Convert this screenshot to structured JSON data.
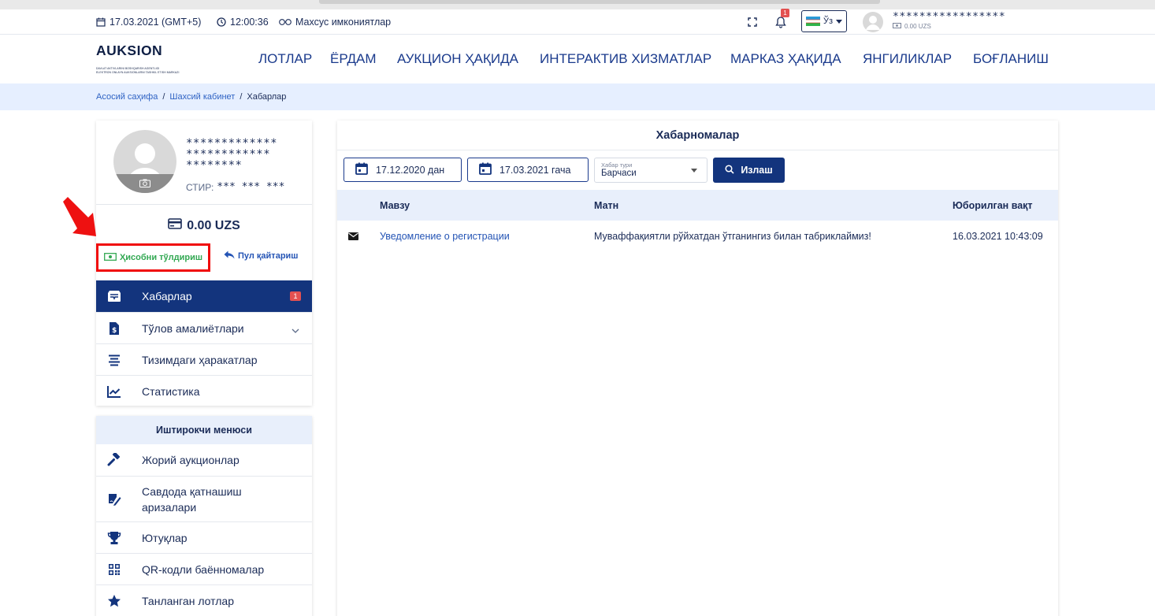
{
  "topbar": {
    "date": "17.03.2021 (GMT+5)",
    "time": "12:00:36",
    "special": "Махсус имкониятлар",
    "notif_count": "1",
    "lang": "Ўз",
    "user_name": "*****************",
    "user_balance": "0.00 UZS"
  },
  "header": {
    "logo_word": "AUKSION",
    "logo_sub1": "DAVLAT AKTIVLARINI BOSHQARISH AGENTLIGI",
    "logo_sub2": "ELEKTRON ONLAYN AUKSIONLARNI TASHKIL ETISH MARKAZI",
    "nav": [
      "ЛОТЛАР",
      "ЁРДАМ",
      "АУКЦИОН ҲАҚИДА",
      "ИНТЕРАКТИВ ХИЗМАТЛАР",
      "МАРКАЗ ҲАҚИДА",
      "ЯНГИЛИКЛАР",
      "БОҒЛАНИШ"
    ]
  },
  "breadcrumb": {
    "home": "Асосий саҳифа",
    "cabinet": "Шахсий кабинет",
    "current": "Хабарлар",
    "sep": "/"
  },
  "profile": {
    "name_lines": [
      "*************",
      "************",
      "********"
    ],
    "stir_label": "СТИР:",
    "stir_value": "*** *** ***",
    "balance": "0.00 UZS",
    "topup_label": "Ҳисобни тўлдириш",
    "refund_label": "Пул қайтариш",
    "menu": [
      {
        "label": "Хабарлар",
        "badge": "1",
        "active": true,
        "icon": "inbox-icon"
      },
      {
        "label": "Тўлов амалиётлари",
        "icon": "payment-doc-icon"
      },
      {
        "label": "Тизимдаги ҳаракатлар",
        "icon": "list-icon"
      },
      {
        "label": "Статистика",
        "icon": "chart-icon"
      }
    ]
  },
  "participant_menu": {
    "title": "Иштирокчи менюси",
    "items": [
      {
        "label": "Жорий аукционлар",
        "icon": "gavel-icon"
      },
      {
        "label": "Савдода қатнашиш",
        "label2": "аризалари",
        "icon": "sign-doc-icon"
      },
      {
        "label": "Ютуқлар",
        "icon": "trophy-icon"
      },
      {
        "label": "QR-кодли баённомалар",
        "icon": "qr-icon"
      },
      {
        "label": "Танланган лотлар",
        "icon": "star-icon"
      }
    ]
  },
  "notifications": {
    "title": "Хабарномалар",
    "date_from": "17.12.2020 дан",
    "date_to": "17.03.2021 гача",
    "type_label": "Хабар тури",
    "type_value": "Барчаси",
    "search_label": "Излаш",
    "columns": [
      "Мавзу",
      "Матн",
      "Юборилган вақт"
    ],
    "rows": [
      {
        "subject": "Уведомление о регистрации",
        "text": "Муваффақиятли рўйхатдан ўтганингиз билан табриклаймиз!",
        "sent": "16.03.2021 10:43:09"
      }
    ]
  },
  "colors": {
    "primary": "#13347d",
    "link": "#2454b5",
    "highlight_box": "#f00a0a",
    "topup_green": "#32a852",
    "badge_red": "#e35151",
    "header_bg": "#e8effb"
  }
}
